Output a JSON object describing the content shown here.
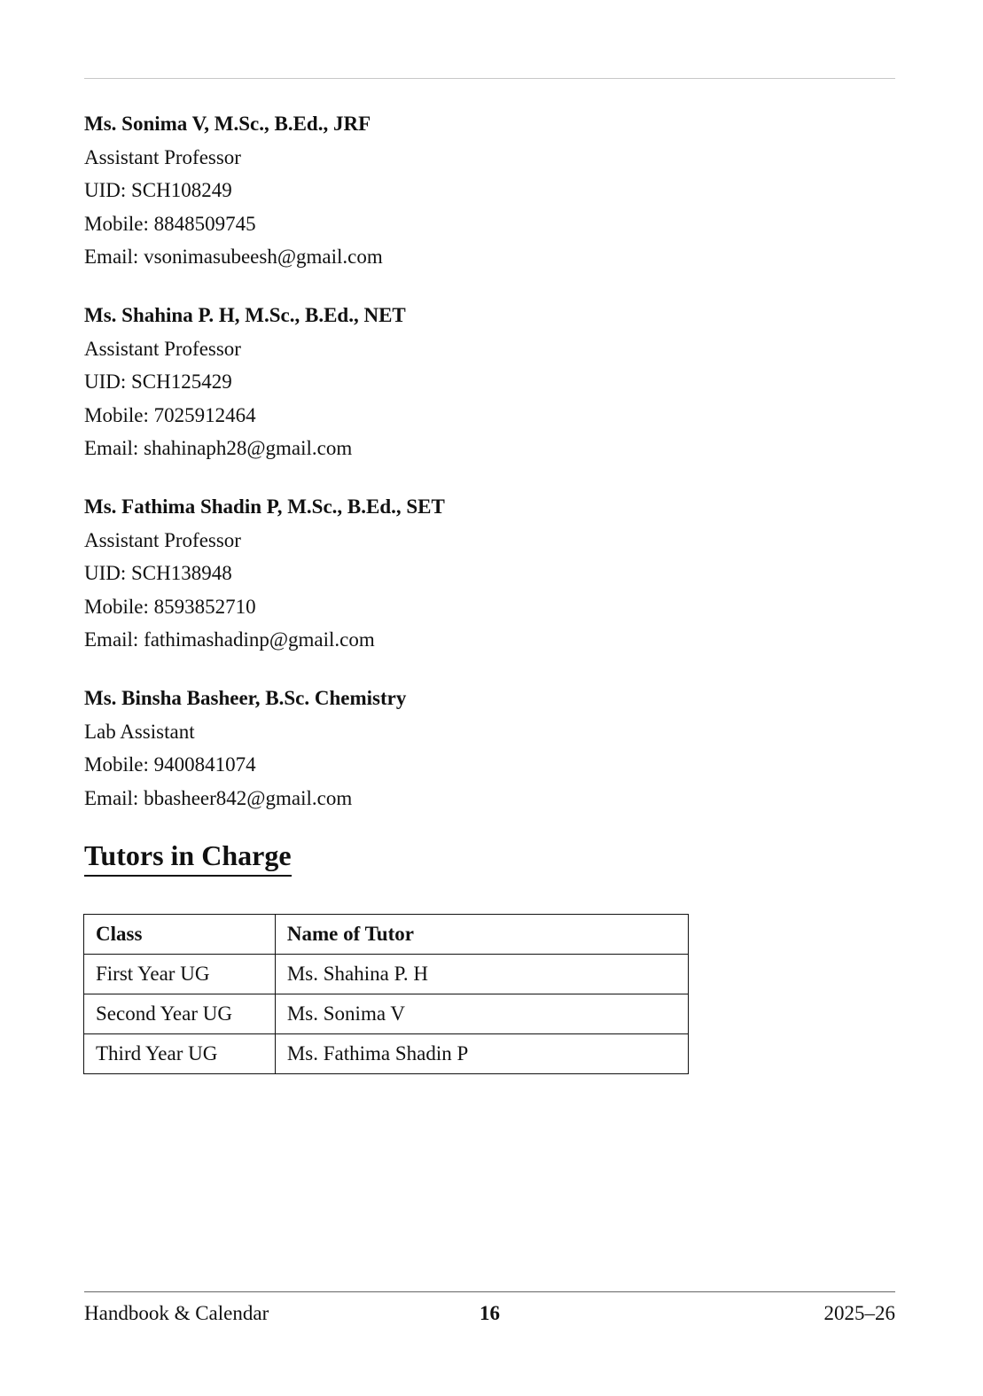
{
  "staff": [
    {
      "name": "Ms.  Sonima V, M.Sc., B.Ed., JRF",
      "designation": "Assistant Professor",
      "uid": "UID: SCH108249",
      "mobile": "Mobile:  8848509745",
      "email": "Email:  vsonimasubeesh@gmail.com"
    },
    {
      "name": "Ms.  Shahina P. H, M.Sc., B.Ed., NET",
      "designation": "Assistant Professor",
      "uid": "UID: SCH125429",
      "mobile": "Mobile:  7025912464",
      "email": "Email:  shahinaph28@gmail.com"
    },
    {
      "name": "Ms.  Fathima Shadin P, M.Sc., B.Ed., SET",
      "designation": "Assistant Professor",
      "uid": "UID: SCH138948",
      "mobile": "Mobile:  8593852710",
      "email": "Email:  fathimashadinp@gmail.com"
    },
    {
      "name": "Ms.  Binsha Basheer, B.Sc.  Chemistry",
      "designation": "Lab Assistant",
      "mobile": "Mobile:  9400841074",
      "email": "Email:  bbasheer842@gmail.com"
    }
  ],
  "tutors_section": {
    "heading": "Tutors in Charge",
    "columns": [
      "Class",
      "Name of Tutor"
    ],
    "rows": [
      [
        "First Year UG",
        "Ms.  Shahina P. H"
      ],
      [
        "Second Year UG",
        "Ms.  Sonima V"
      ],
      [
        "Third Year UG",
        "Ms.  Fathima Shadin P"
      ]
    ]
  },
  "footer": {
    "left": "Handbook & Calendar",
    "page_number": "16",
    "right": "2025–26"
  }
}
